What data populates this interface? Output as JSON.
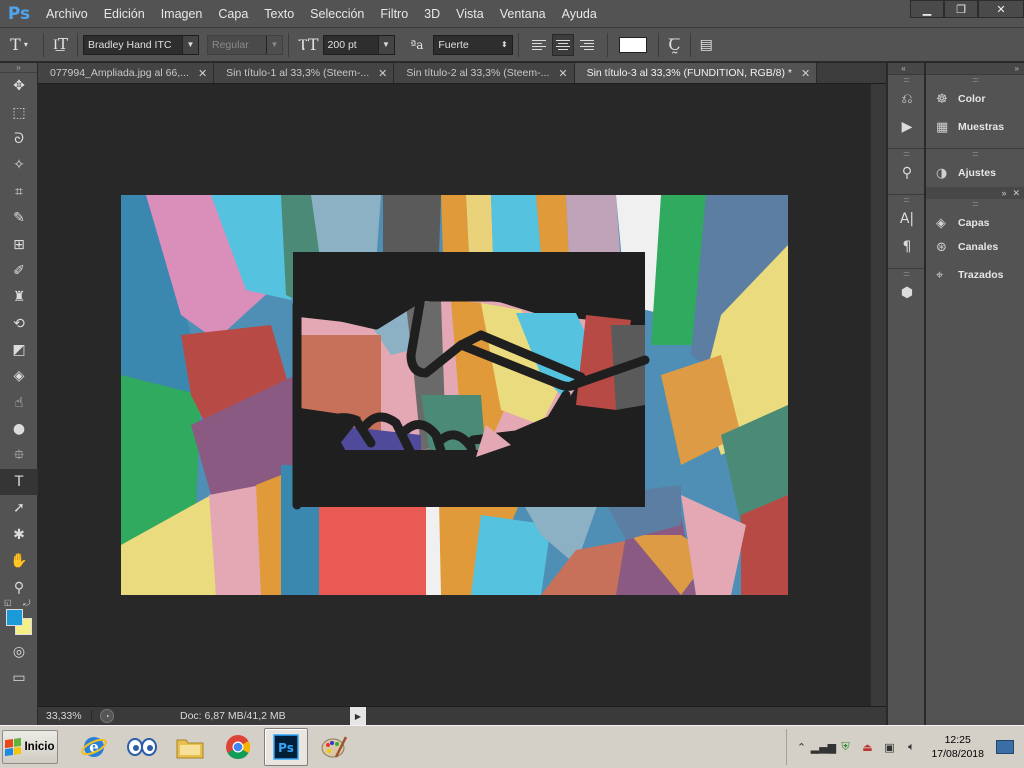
{
  "app": {
    "logo": "Ps",
    "menu": [
      "Archivo",
      "Edición",
      "Imagen",
      "Capa",
      "Texto",
      "Selección",
      "Filtro",
      "3D",
      "Vista",
      "Ventana",
      "Ayuda"
    ],
    "window_controls": [
      "minimize-icon",
      "restore-icon",
      "close-icon"
    ]
  },
  "options_bar": {
    "tool_icon": "T",
    "font_family": "Bradley Hand ITC",
    "font_style": "Regular",
    "font_size": "200 pt",
    "antialias_icon": "ªa",
    "antialias": "Fuerte",
    "text_color": "#ffffff"
  },
  "tabs": [
    {
      "label": "077994_Ampliada.jpg al 66,...",
      "active": false
    },
    {
      "label": "Sin título-1 al 33,3% (Steem-...",
      "active": false
    },
    {
      "label": "Sin título-2 al 33,3% (Steem-...",
      "active": false
    },
    {
      "label": "Sin título-3 al 33,3% (FUNDITION, RGB/8) *",
      "active": true
    }
  ],
  "tools": [
    {
      "name": "move-tool",
      "icon": "✥"
    },
    {
      "name": "marquee-tool",
      "icon": "⬚"
    },
    {
      "name": "lasso-tool",
      "icon": "ᘐ"
    },
    {
      "name": "magic-wand-tool",
      "icon": "✧"
    },
    {
      "name": "crop-tool",
      "icon": "⌗"
    },
    {
      "name": "eyedropper-tool",
      "icon": "✎"
    },
    {
      "name": "healing-brush-tool",
      "icon": "⊞"
    },
    {
      "name": "brush-tool",
      "icon": "✐"
    },
    {
      "name": "clone-stamp-tool",
      "icon": "♜"
    },
    {
      "name": "history-brush-tool",
      "icon": "⟲"
    },
    {
      "name": "eraser-tool",
      "icon": "◩"
    },
    {
      "name": "paint-bucket-tool",
      "icon": "◈"
    },
    {
      "name": "smudge-tool",
      "icon": "☝"
    },
    {
      "name": "dodge-tool",
      "icon": "●"
    },
    {
      "name": "pen-tool",
      "icon": "⯐"
    },
    {
      "name": "type-tool",
      "icon": "T",
      "active": true
    },
    {
      "name": "path-selection-tool",
      "icon": "➚"
    },
    {
      "name": "shape-tool",
      "icon": "✱"
    },
    {
      "name": "hand-tool",
      "icon": "✋"
    },
    {
      "name": "zoom-tool",
      "icon": "⚲"
    }
  ],
  "colors": {
    "foreground": "#1a9bd7",
    "background": "#f4ef86"
  },
  "status": {
    "zoom": "33,33%",
    "doc": "Doc: 6,87 MB/41,2 MB"
  },
  "right_narrow_icons": [
    "history-icon",
    "actions-icon",
    "brushes-icon",
    "character-icon",
    "paragraph-icon",
    "3d-icon"
  ],
  "right_panels": {
    "group1": [
      {
        "label": "Color",
        "icon": "palette-icon"
      },
      {
        "label": "Muestras",
        "icon": "swatches-icon"
      }
    ],
    "group2": [
      {
        "label": "Ajustes",
        "icon": "adjustments-icon"
      }
    ],
    "group3": [
      {
        "label": "Capas",
        "icon": "layers-icon"
      },
      {
        "label": "Canales",
        "icon": "channels-icon"
      },
      {
        "label": "Trazados",
        "icon": "paths-icon"
      }
    ]
  },
  "taskbar": {
    "start": "Inicio",
    "apps": [
      "ie-icon",
      "eyes-icon",
      "folder-icon",
      "chrome-icon",
      "photoshop-icon",
      "paint-icon"
    ],
    "time": "12:25",
    "date": "17/08/2018"
  }
}
